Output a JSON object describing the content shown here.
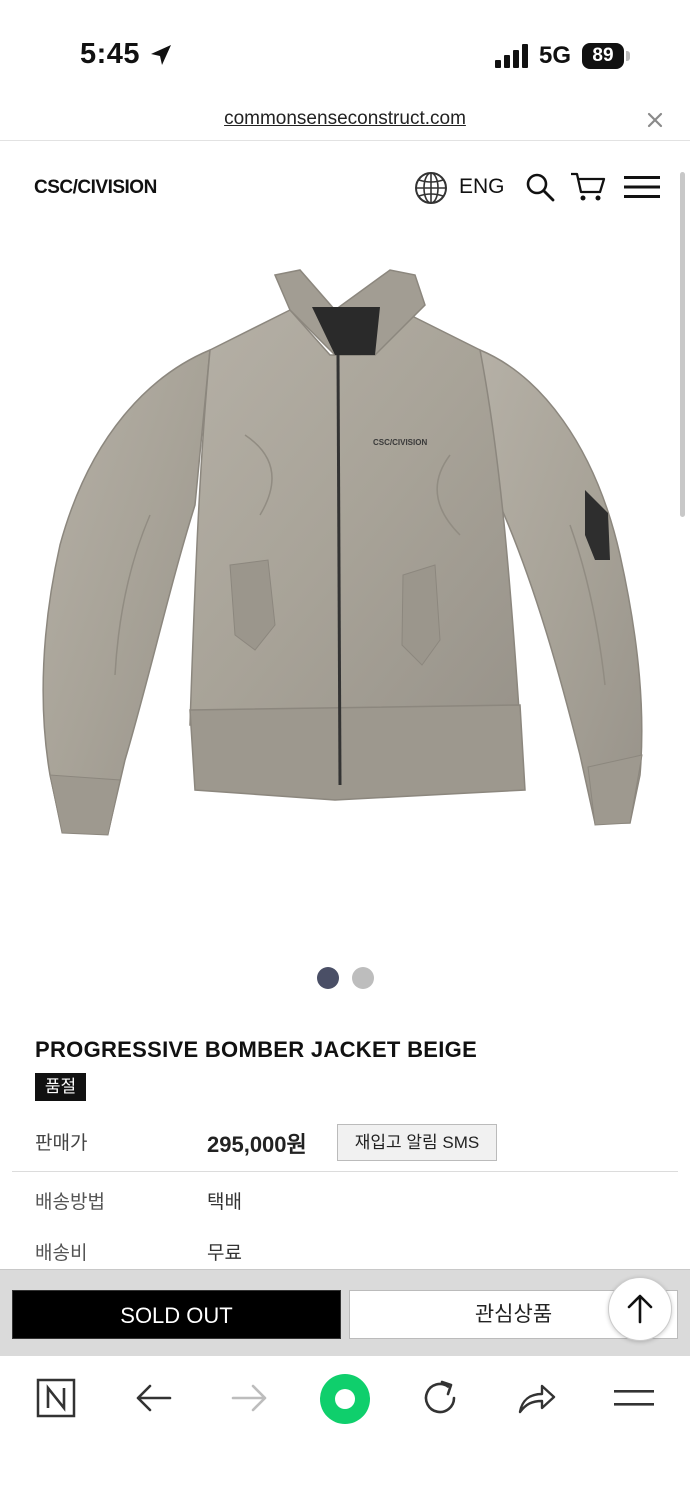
{
  "status_bar": {
    "time": "5:45",
    "network": "5G",
    "battery": "89"
  },
  "browser": {
    "url": "commonsenseconstruct.com"
  },
  "header": {
    "logo": "CSC/CIVISION",
    "language": "ENG"
  },
  "product": {
    "name": "PROGRESSIVE BOMBER JACKET BEIGE",
    "badge": "품절",
    "price_label": "판매가",
    "price": "295,000원",
    "restock_button": "재입고 알림 SMS",
    "shipping_method_label": "배송방법",
    "shipping_method": "택배",
    "shipping_fee_label": "배송비",
    "shipping_fee": "무료",
    "image_count": 2,
    "active_image": 1,
    "jacket_print": "CSC/CIVISION",
    "colors": {
      "jacket": "#a8a398",
      "active_dot": "#4a4f66",
      "inactive_dot": "#bdbdbd"
    }
  },
  "actions": {
    "sold_out": "SOLD OUT",
    "wishlist": "관심상품"
  },
  "toolbar_icons": [
    "n-icon",
    "back-arrow-icon",
    "forward-arrow-icon",
    "green-dot-icon",
    "reload-icon",
    "share-icon",
    "menu-icon"
  ]
}
